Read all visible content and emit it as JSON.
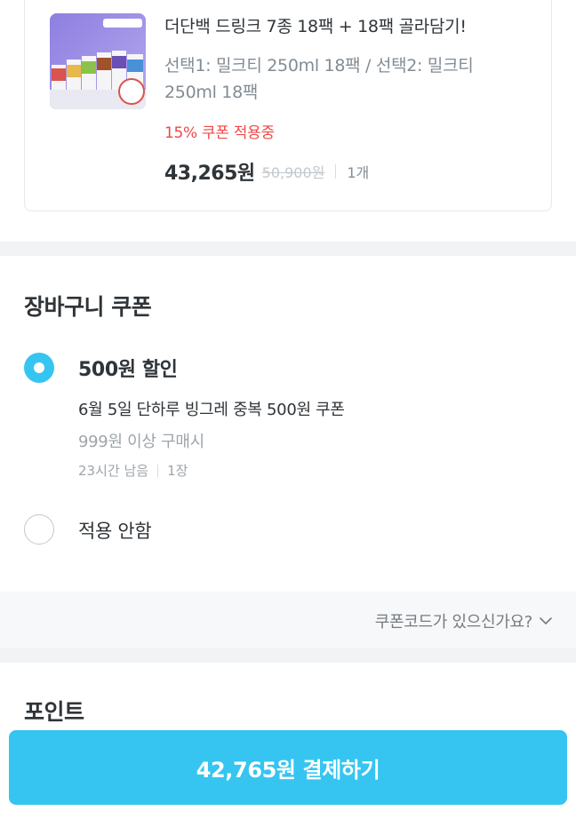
{
  "product": {
    "image_alt": "drink product thumbnail",
    "badge": "18팩\n+18팩",
    "name": "더단백 드링크 7종 18팩 + 18팩 골라담기!",
    "option": "선택1: 밀크티 250ml 18팩 / 선택2: 밀크티 250ml 18팩",
    "coupon_applied": "15% 쿠폰 적용중",
    "sale_price": "43,265원",
    "original_price": "50,900원",
    "quantity": "1개"
  },
  "cart_coupon": {
    "title": "장바구니 쿠폰",
    "options": [
      {
        "selected": true,
        "title": "500원 할인",
        "description": "6월 5일 단하루 빙그레 중복 500원 쿠폰",
        "condition": "999원 이상 구매시",
        "time_left": "23시간 남음",
        "count": "1장"
      },
      {
        "selected": false,
        "title": "적용 안함"
      }
    ],
    "code_link": "쿠폰코드가 있으신가요?"
  },
  "points": {
    "title": "포인트"
  },
  "checkout": {
    "button_label": "42,765원 결제하기"
  },
  "colors": {
    "accent": "#35c5f0",
    "coupon_red": "#f04848",
    "text_primary": "#2f3438",
    "text_secondary": "#828c94"
  }
}
